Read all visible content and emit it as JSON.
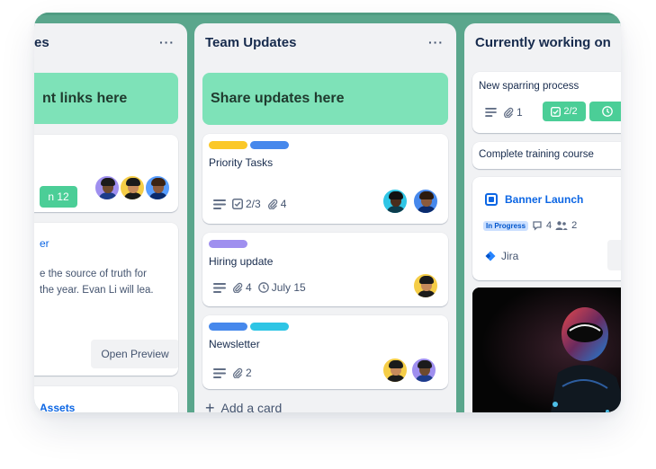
{
  "colors": {
    "board_bg": "#5aa68c",
    "list_bg": "#f1f2f4",
    "green_card": "#7ee2b8",
    "label_yellow": "#fbc828",
    "label_blue": "#4688ec",
    "label_purple": "#9f8fef",
    "label_cyan": "#2ec5e5",
    "link_blue": "#0c66e4"
  },
  "list1": {
    "title": "es",
    "green_card_text": "nt links here",
    "due_badge": "n 12",
    "card2_link": "er",
    "card2_line1": "e the source of truth for",
    "card2_line2": "the year. Evan Li will lea.",
    "open_preview": "Open Preview",
    "assets_link": "Assets"
  },
  "list2": {
    "title": "Team Updates",
    "green_card_text": "Share updates here",
    "cards": [
      {
        "title": "Priority Tasks",
        "checklist": "2/3",
        "attachments": "4"
      },
      {
        "title": "Hiring update",
        "attachments": "4",
        "due": "July 15"
      },
      {
        "title": "Newsletter",
        "attachments": "2"
      }
    ],
    "add_card": "Add a card"
  },
  "list3": {
    "title": "Currently working on",
    "card1": {
      "title": "New sparring process",
      "attachments": "1",
      "checklist": "2/2"
    },
    "card2": {
      "title": "Complete training course"
    },
    "card3": {
      "title": "Banner Launch",
      "status": "In Progress",
      "comments": "4",
      "members": "2",
      "jira": "Jira"
    }
  },
  "icons": {
    "more": "more-icon",
    "description": "description-icon",
    "checklist": "checklist-icon",
    "attachment": "paperclip-icon",
    "clock": "clock-icon",
    "plus": "plus-icon"
  }
}
